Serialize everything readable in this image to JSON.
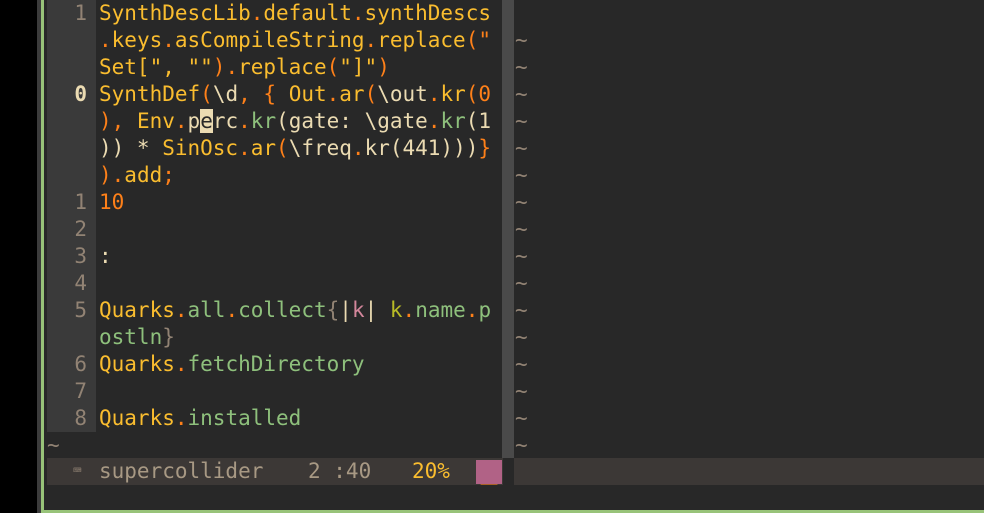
{
  "editor": {
    "lines": [
      {
        "num": "1",
        "current": false,
        "tokens": [
          {
            "t": "SynthDescLib",
            "c": "y"
          },
          {
            "t": ".",
            "c": "o"
          },
          {
            "t": "default",
            "c": "y"
          },
          {
            "t": ".",
            "c": "o"
          },
          {
            "t": "synthDescs",
            "c": "y"
          }
        ]
      },
      {
        "num": "",
        "current": false,
        "tokens": [
          {
            "t": ".",
            "c": "o"
          },
          {
            "t": "keys",
            "c": "y"
          },
          {
            "t": ".",
            "c": "o"
          },
          {
            "t": "asCompileString",
            "c": "y"
          },
          {
            "t": ".",
            "c": "o"
          },
          {
            "t": "replace",
            "c": "y"
          },
          {
            "t": "(\"",
            "c": "o"
          }
        ]
      },
      {
        "num": "",
        "current": false,
        "tokens": [
          {
            "t": "Set[\", \"\"",
            "c": "y"
          },
          {
            "t": ").",
            "c": "o"
          },
          {
            "t": "replace",
            "c": "y"
          },
          {
            "t": "(",
            "c": "o"
          },
          {
            "t": "\"]\"",
            "c": "y"
          },
          {
            "t": ")",
            "c": "o"
          }
        ]
      },
      {
        "num": "0",
        "current": true,
        "tokens": [
          {
            "t": "SynthDef",
            "c": "y"
          },
          {
            "t": "(",
            "c": "o"
          },
          {
            "t": "\\d",
            "c": "f"
          },
          {
            "t": ", { ",
            "c": "o"
          },
          {
            "t": "Out",
            "c": "y"
          },
          {
            "t": ".",
            "c": "o"
          },
          {
            "t": "ar",
            "c": "y"
          },
          {
            "t": "(",
            "c": "o"
          },
          {
            "t": "\\out",
            "c": "f"
          },
          {
            "t": ".",
            "c": "o"
          },
          {
            "t": "kr",
            "c": "y"
          },
          {
            "t": "(",
            "c": "o"
          },
          {
            "t": "0",
            "c": "o"
          }
        ]
      },
      {
        "num": "",
        "current": false,
        "tokens": [
          {
            "t": "), ",
            "c": "o"
          },
          {
            "t": "Env",
            "c": "y"
          },
          {
            "t": ".",
            "c": "o"
          },
          {
            "t": "p",
            "c": "f"
          },
          {
            "t": "e",
            "c": "cursor"
          },
          {
            "t": "rc",
            "c": "f"
          },
          {
            "t": ".",
            "c": "o"
          },
          {
            "t": "kr",
            "c": "aq"
          },
          {
            "t": "(gate: ",
            "c": "f"
          },
          {
            "t": "\\gate",
            "c": "f"
          },
          {
            "t": ".",
            "c": "o"
          },
          {
            "t": "kr",
            "c": "aq"
          },
          {
            "t": "(1",
            "c": "f"
          }
        ]
      },
      {
        "num": "",
        "current": false,
        "tokens": [
          {
            "t": ")) * ",
            "c": "f"
          },
          {
            "t": "SinOsc",
            "c": "y"
          },
          {
            "t": ".",
            "c": "o"
          },
          {
            "t": "ar",
            "c": "y"
          },
          {
            "t": "(",
            "c": "o"
          },
          {
            "t": "\\freq",
            "c": "f"
          },
          {
            "t": ".",
            "c": "o"
          },
          {
            "t": "kr",
            "c": "f"
          },
          {
            "t": "(441)))",
            "c": "f"
          },
          {
            "t": "}",
            "c": "o"
          }
        ]
      },
      {
        "num": "",
        "current": false,
        "tokens": [
          {
            "t": ").",
            "c": "o"
          },
          {
            "t": "add",
            "c": "y"
          },
          {
            "t": ";",
            "c": "o"
          }
        ]
      },
      {
        "num": "1",
        "current": false,
        "tokens": [
          {
            "t": "10",
            "c": "o"
          }
        ]
      },
      {
        "num": "2",
        "current": false,
        "tokens": []
      },
      {
        "num": "3",
        "current": false,
        "tokens": [
          {
            "t": ":",
            "c": "f"
          }
        ]
      },
      {
        "num": "4",
        "current": false,
        "tokens": []
      },
      {
        "num": "5",
        "current": false,
        "tokens": [
          {
            "t": "Quarks",
            "c": "y"
          },
          {
            "t": ".",
            "c": "o"
          },
          {
            "t": "all",
            "c": "aq"
          },
          {
            "t": ".",
            "c": "o"
          },
          {
            "t": "collect",
            "c": "aq"
          },
          {
            "t": "{",
            "c": "gr"
          },
          {
            "t": "|",
            "c": "f"
          },
          {
            "t": "k",
            "c": "m"
          },
          {
            "t": "| ",
            "c": "f"
          },
          {
            "t": "k",
            "c": "g"
          },
          {
            "t": ".",
            "c": "o"
          },
          {
            "t": "name",
            "c": "aq"
          },
          {
            "t": ".",
            "c": "o"
          },
          {
            "t": "p",
            "c": "aq"
          }
        ]
      },
      {
        "num": "",
        "current": false,
        "tokens": [
          {
            "t": "ostln",
            "c": "aq"
          },
          {
            "t": "}",
            "c": "gr"
          }
        ]
      },
      {
        "num": "6",
        "current": false,
        "tokens": [
          {
            "t": "Quarks",
            "c": "y"
          },
          {
            "t": ".",
            "c": "o"
          },
          {
            "t": "fetchDirectory",
            "c": "aq"
          }
        ]
      },
      {
        "num": "7",
        "current": false,
        "tokens": []
      },
      {
        "num": "8",
        "current": false,
        "tokens": [
          {
            "t": "Quarks",
            "c": "y"
          },
          {
            "t": ".",
            "c": "o"
          },
          {
            "t": "installed",
            "c": "aq"
          }
        ]
      }
    ],
    "eob_tilde": "~",
    "right_pane_tilde": "~"
  },
  "statusline": {
    "icon": "keyboard-icon",
    "icon_glyph": "⌨",
    "filetype": "supercollider",
    "position": "2 :40",
    "percent": "20%",
    "mode_mark": "__"
  },
  "colors": {
    "background": "#282828",
    "accent_green": "#98c379",
    "keyword_yellow": "#fabd2f",
    "punct_orange": "#fe8019",
    "aqua": "#8ec07c",
    "mode_magenta": "#b16286"
  }
}
